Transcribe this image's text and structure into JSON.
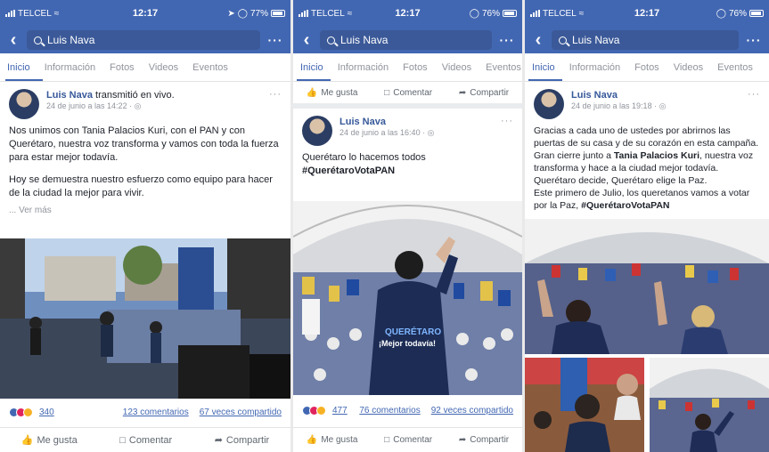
{
  "panels": [
    {
      "status": {
        "carrier": "TELCEL",
        "time": "12:17",
        "battery": "77%"
      },
      "search": "Luis Nava",
      "tabs": [
        "Inicio",
        "Información",
        "Fotos",
        "Videos",
        "Eventos"
      ],
      "post": {
        "author": "Luis Nava",
        "action": "transmitió en vivo.",
        "date": "24 de junio a las 14:22 · ",
        "text": [
          "Nos unimos con Tania Palacios Kuri, con el PAN y con Querétaro, nuestra voz transforma y vamos con toda la fuerza para estar mejor todavía.",
          "Hoy se demuestra nuestro esfuerzo como equipo para hacer de la  ciudad la mejor para vivir."
        ],
        "see_more": "... Ver más",
        "reactions_count": "340",
        "comments": "123 comentarios",
        "shares": "67 veces compartido"
      },
      "actions": {
        "like": "Me gusta",
        "comment": "Comentar",
        "share": "Compartir"
      }
    },
    {
      "status": {
        "carrier": "TELCEL",
        "time": "12:17",
        "battery": "76%"
      },
      "search": "Luis Nava",
      "tabs": [
        "Inicio",
        "Información",
        "Fotos",
        "Videos",
        "Eventos"
      ],
      "top_actions": {
        "like": "Me gusta",
        "comment": "Comentar",
        "share": "Compartir"
      },
      "post": {
        "author": "Luis Nava",
        "date": "24 de junio a las 16:40 · ",
        "text_plain": "Querétaro lo hacemos todos ",
        "hashtag": "#QuerétaroVotaPAN",
        "shirt_text_1": "QUERÉTARO",
        "shirt_text_2": "¡Mejor todavía!",
        "reactions_count": "477",
        "comments": "76 comentarios",
        "shares": "92 veces compartido"
      },
      "actions": {
        "like": "Me gusta",
        "comment": "Comentar",
        "share": "Compartir"
      }
    },
    {
      "status": {
        "carrier": "TELCEL",
        "time": "12:17",
        "battery": "76%"
      },
      "search": "Luis Nava",
      "tabs": [
        "Inicio",
        "Información",
        "Fotos",
        "Videos",
        "Eventos"
      ],
      "post": {
        "author": "Luis Nava",
        "date": "24 de junio a las 19:18 · ",
        "line1": "Gracias a cada uno de ustedes por abrirnos las puertas de su casa y de su corazón en esta campaña.",
        "line2a": "Gran cierre junto a ",
        "line2b": "Tania Palacios Kuri",
        "line2c": ", nuestra voz transforma y hace a la ciudad mejor todavía.",
        "line3": "Querétaro decide, Querétaro elige la Paz.",
        "line4": "Este primero de Julio, los queretanos vamos a votar por la Paz, ",
        "hashtag": "#QuerétaroVotaPAN"
      }
    }
  ],
  "colors": {
    "brand": "#4267b2",
    "link": "#365899",
    "muted": "#90949c"
  }
}
